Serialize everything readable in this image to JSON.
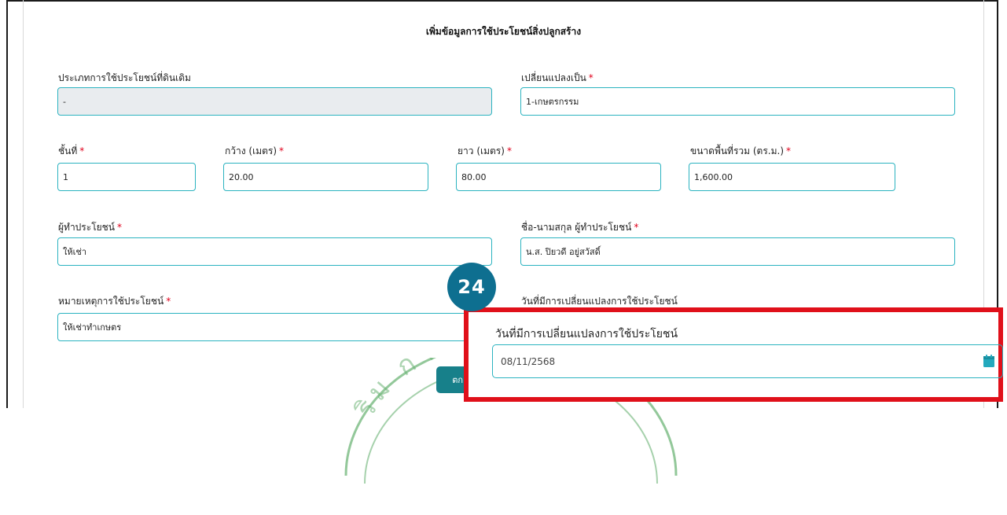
{
  "form": {
    "title": "เพิ่มข้อมูลการใช้ประโยชน์สิ่งปลูกสร้าง",
    "required_mark": "*",
    "original_use": {
      "label": "ประเภทการใช้ประโยชน์ที่ดินเดิม",
      "value": "-"
    },
    "changed_to": {
      "label": "เปลี่ยนแปลงเป็น",
      "value": "1-เกษตรกรรม"
    },
    "floor": {
      "label": "ชั้นที่",
      "value": "1"
    },
    "width": {
      "label": "กว้าง (เมตร)",
      "value": "20.00"
    },
    "length": {
      "label": "ยาว (เมตร)",
      "value": "80.00"
    },
    "total_area": {
      "label": "ขนาดพื้นที่รวม (ตร.ม.)",
      "value": "1,600.00"
    },
    "user": {
      "label": "ผู้ทำประโยชน์",
      "value": "ให้เช่า"
    },
    "user_name": {
      "label": "ชื่อ-นามสกุล ผู้ทำประโยชน์",
      "value": "น.ส. ปิยวดี อยู่สวัสดิ์"
    },
    "usage_note": {
      "label": "หมายเหตุการใช้ประโยชน์",
      "value": "ให้เช่าทำเกษตร"
    },
    "change_date": {
      "label": "วันที่มีการเปลี่ยนแปลงการใช้ประโยชน์"
    },
    "save_label": "ตก"
  },
  "annotation": {
    "step_number": "24",
    "callout_label": "วันที่มีการเปลี่ยนแปลงการใช้ประโยชน์",
    "date_value": "08/11/2568",
    "icon": "calendar-icon"
  },
  "watermark": {
    "text": "ริม การปกครอง"
  },
  "colors": {
    "field_border": "#2bb3c0",
    "badge": "#0e6f90",
    "callout_border": "#e0101a",
    "required": "#e0001b"
  }
}
